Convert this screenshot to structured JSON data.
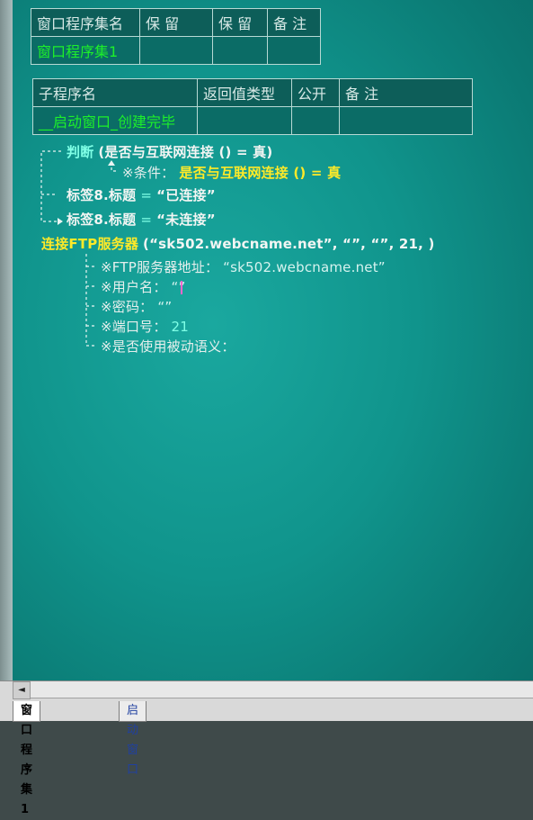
{
  "window_table": {
    "headers": [
      "窗口程序集名",
      "保 留",
      "保 留",
      "备 注"
    ],
    "values": [
      "窗口程序集1",
      "",
      "",
      ""
    ]
  },
  "sub_table": {
    "headers": [
      "子程序名",
      "返回值类型",
      "公开",
      "备 注"
    ],
    "values": [
      "__启动窗口_创建完毕",
      "",
      "",
      ""
    ]
  },
  "code": {
    "if_keyword": "判断",
    "if_expr": "(是否与互联网连接 () = 真)",
    "cond_label": "※条件：",
    "cond_value": "是否与互联网连接 () = 真",
    "line_a_left": "标签8.标题",
    "line_a_eq": "=",
    "line_a_right": "“已连接”",
    "line_b_left": "标签8.标题",
    "line_b_eq": "=",
    "line_b_right": "“未连接”",
    "ftp_call": "连接FTP服务器",
    "ftp_args": "(“sk502.webcname.net”, “”, “”, 21, )",
    "params": [
      {
        "label": "※FTP服务器地址：",
        "value": "“sk502.webcname.net”"
      },
      {
        "label": "※用户名：",
        "value": "“”"
      },
      {
        "label": "※密码：",
        "value": "“”"
      },
      {
        "label": "※端口号：",
        "value": "21"
      },
      {
        "label": "※是否使用被动语义：",
        "value": ""
      }
    ]
  },
  "tabs": [
    "窗口程序集1",
    "启动窗口"
  ],
  "scroll_left_glyph": "◄",
  "colors": {
    "background": "#10948c",
    "keyword": "#ffea28",
    "green": "#1df02a"
  }
}
